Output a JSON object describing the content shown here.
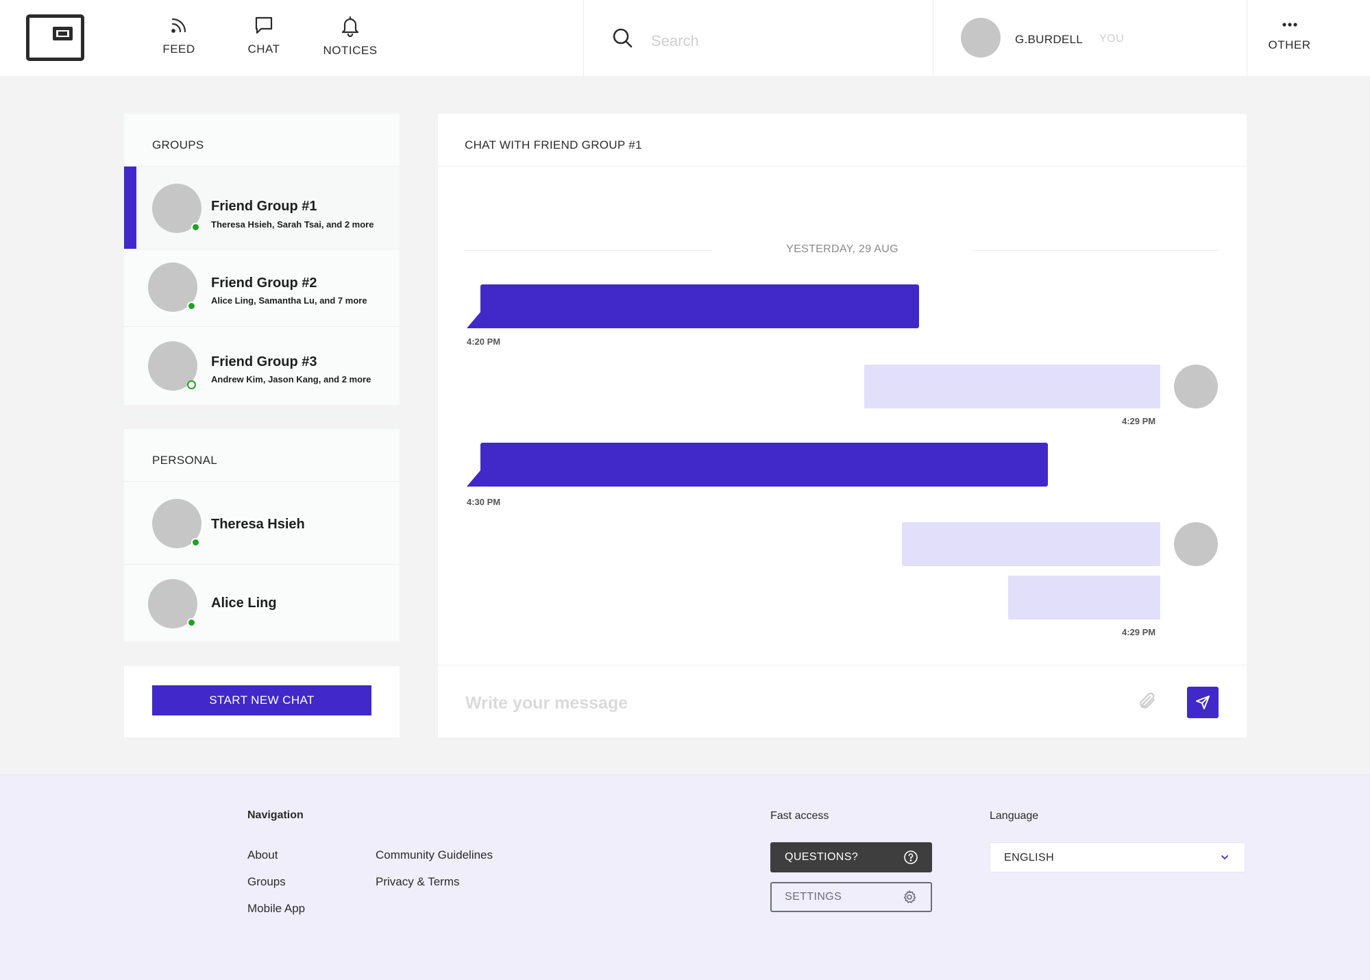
{
  "header": {
    "nav": [
      {
        "label": "FEED",
        "icon": "rss-icon"
      },
      {
        "label": "CHAT",
        "icon": "chat-bubble-icon"
      },
      {
        "label": "NOTICES",
        "icon": "bell-icon"
      }
    ],
    "search": {
      "placeholder": "Search"
    },
    "user": {
      "name": "G.BURDELL",
      "tag": "YOU"
    },
    "other_label": "OTHER"
  },
  "sidebar": {
    "groups_title": "GROUPS",
    "groups": [
      {
        "name": "Friend Group #1",
        "members": "Theresa Hsieh, Sarah Tsai, and 2 more",
        "status": "online",
        "active": true
      },
      {
        "name": "Friend Group #2",
        "members": "Alice Ling, Samantha Lu, and 7 more",
        "status": "online",
        "active": false
      },
      {
        "name": "Friend Group #3",
        "members": "Andrew Kim, Jason Kang, and 2 more",
        "status": "away",
        "active": false
      }
    ],
    "personal_title": "PERSONAL",
    "personal": [
      {
        "name": "Theresa Hsieh",
        "status": "online"
      },
      {
        "name": "Alice Ling",
        "status": "online"
      }
    ],
    "start_chat_label": "START NEW CHAT"
  },
  "chat": {
    "title": "CHAT WITH FRIEND GROUP #1",
    "day_divider": "YESTERDAY, 29 AUG",
    "messages": [
      {
        "direction": "incoming",
        "time": "4:20 PM"
      },
      {
        "direction": "outgoing",
        "time": "4:29 PM"
      },
      {
        "direction": "incoming",
        "time": "4:30 PM"
      },
      {
        "direction": "outgoing",
        "time": "4:29 PM"
      }
    ],
    "compose_placeholder": "Write your message"
  },
  "footer": {
    "navigation_title": "Navigation",
    "links_col1": [
      "About",
      "Groups",
      "Mobile App"
    ],
    "links_col2": [
      "Community Guidelines",
      "Privacy & Terms"
    ],
    "fast_access_title": "Fast access",
    "questions_label": "QUESTIONS?",
    "settings_label": "SETTINGS",
    "language_title": "Language",
    "language_value": "ENGLISH"
  },
  "colors": {
    "accent": "#4128c9",
    "incoming_bubble": "#4128c9",
    "outgoing_bubble": "#e2dffa",
    "online_status": "#1ea31e",
    "footer_bg": "#efeefa"
  }
}
